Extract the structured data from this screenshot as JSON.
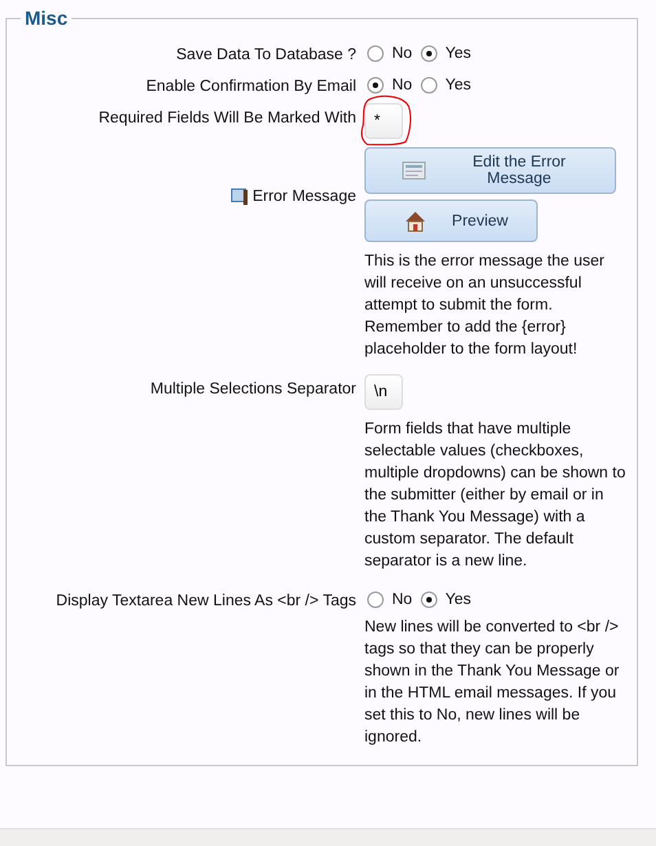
{
  "legend": "Misc",
  "rows": [
    {
      "kind": "radio",
      "label": "Save Data To Database ?",
      "options": [
        {
          "label": "No",
          "selected": false
        },
        {
          "label": "Yes",
          "selected": true
        }
      ]
    },
    {
      "kind": "radio",
      "label": "Enable Confirmation By Email",
      "options": [
        {
          "label": "No",
          "selected": true
        },
        {
          "label": "Yes",
          "selected": false
        }
      ]
    },
    {
      "kind": "field",
      "label": "Required Fields Will Be Marked With",
      "value": "*",
      "annotated": true
    },
    {
      "kind": "buttons",
      "label": "Error Message",
      "buttons": [
        {
          "label": "Edit the Error Message"
        },
        {
          "label": "Preview"
        }
      ],
      "help": "This is the error message the user will receive on an unsuccessful attempt to submit the form. Remember to add the {error} placeholder to the form layout!"
    },
    {
      "kind": "field",
      "label": "Multiple Selections Separator",
      "value": "\\n",
      "help": "Form fields that have multiple selectable values (checkboxes, multiple dropdowns) can be shown to the submitter (either by email or in the Thank You Message) with a custom separator. The default separator is a new line."
    },
    {
      "kind": "radio",
      "label": "Display Textarea New Lines As <br /> Tags",
      "options": [
        {
          "label": "No",
          "selected": false
        },
        {
          "label": "Yes",
          "selected": true
        }
      ],
      "help": "New lines will be converted to <br /> tags so that they can be properly shown in the Thank You Message or in the HTML email messages. If you set this to No, new lines will be ignored."
    }
  ]
}
